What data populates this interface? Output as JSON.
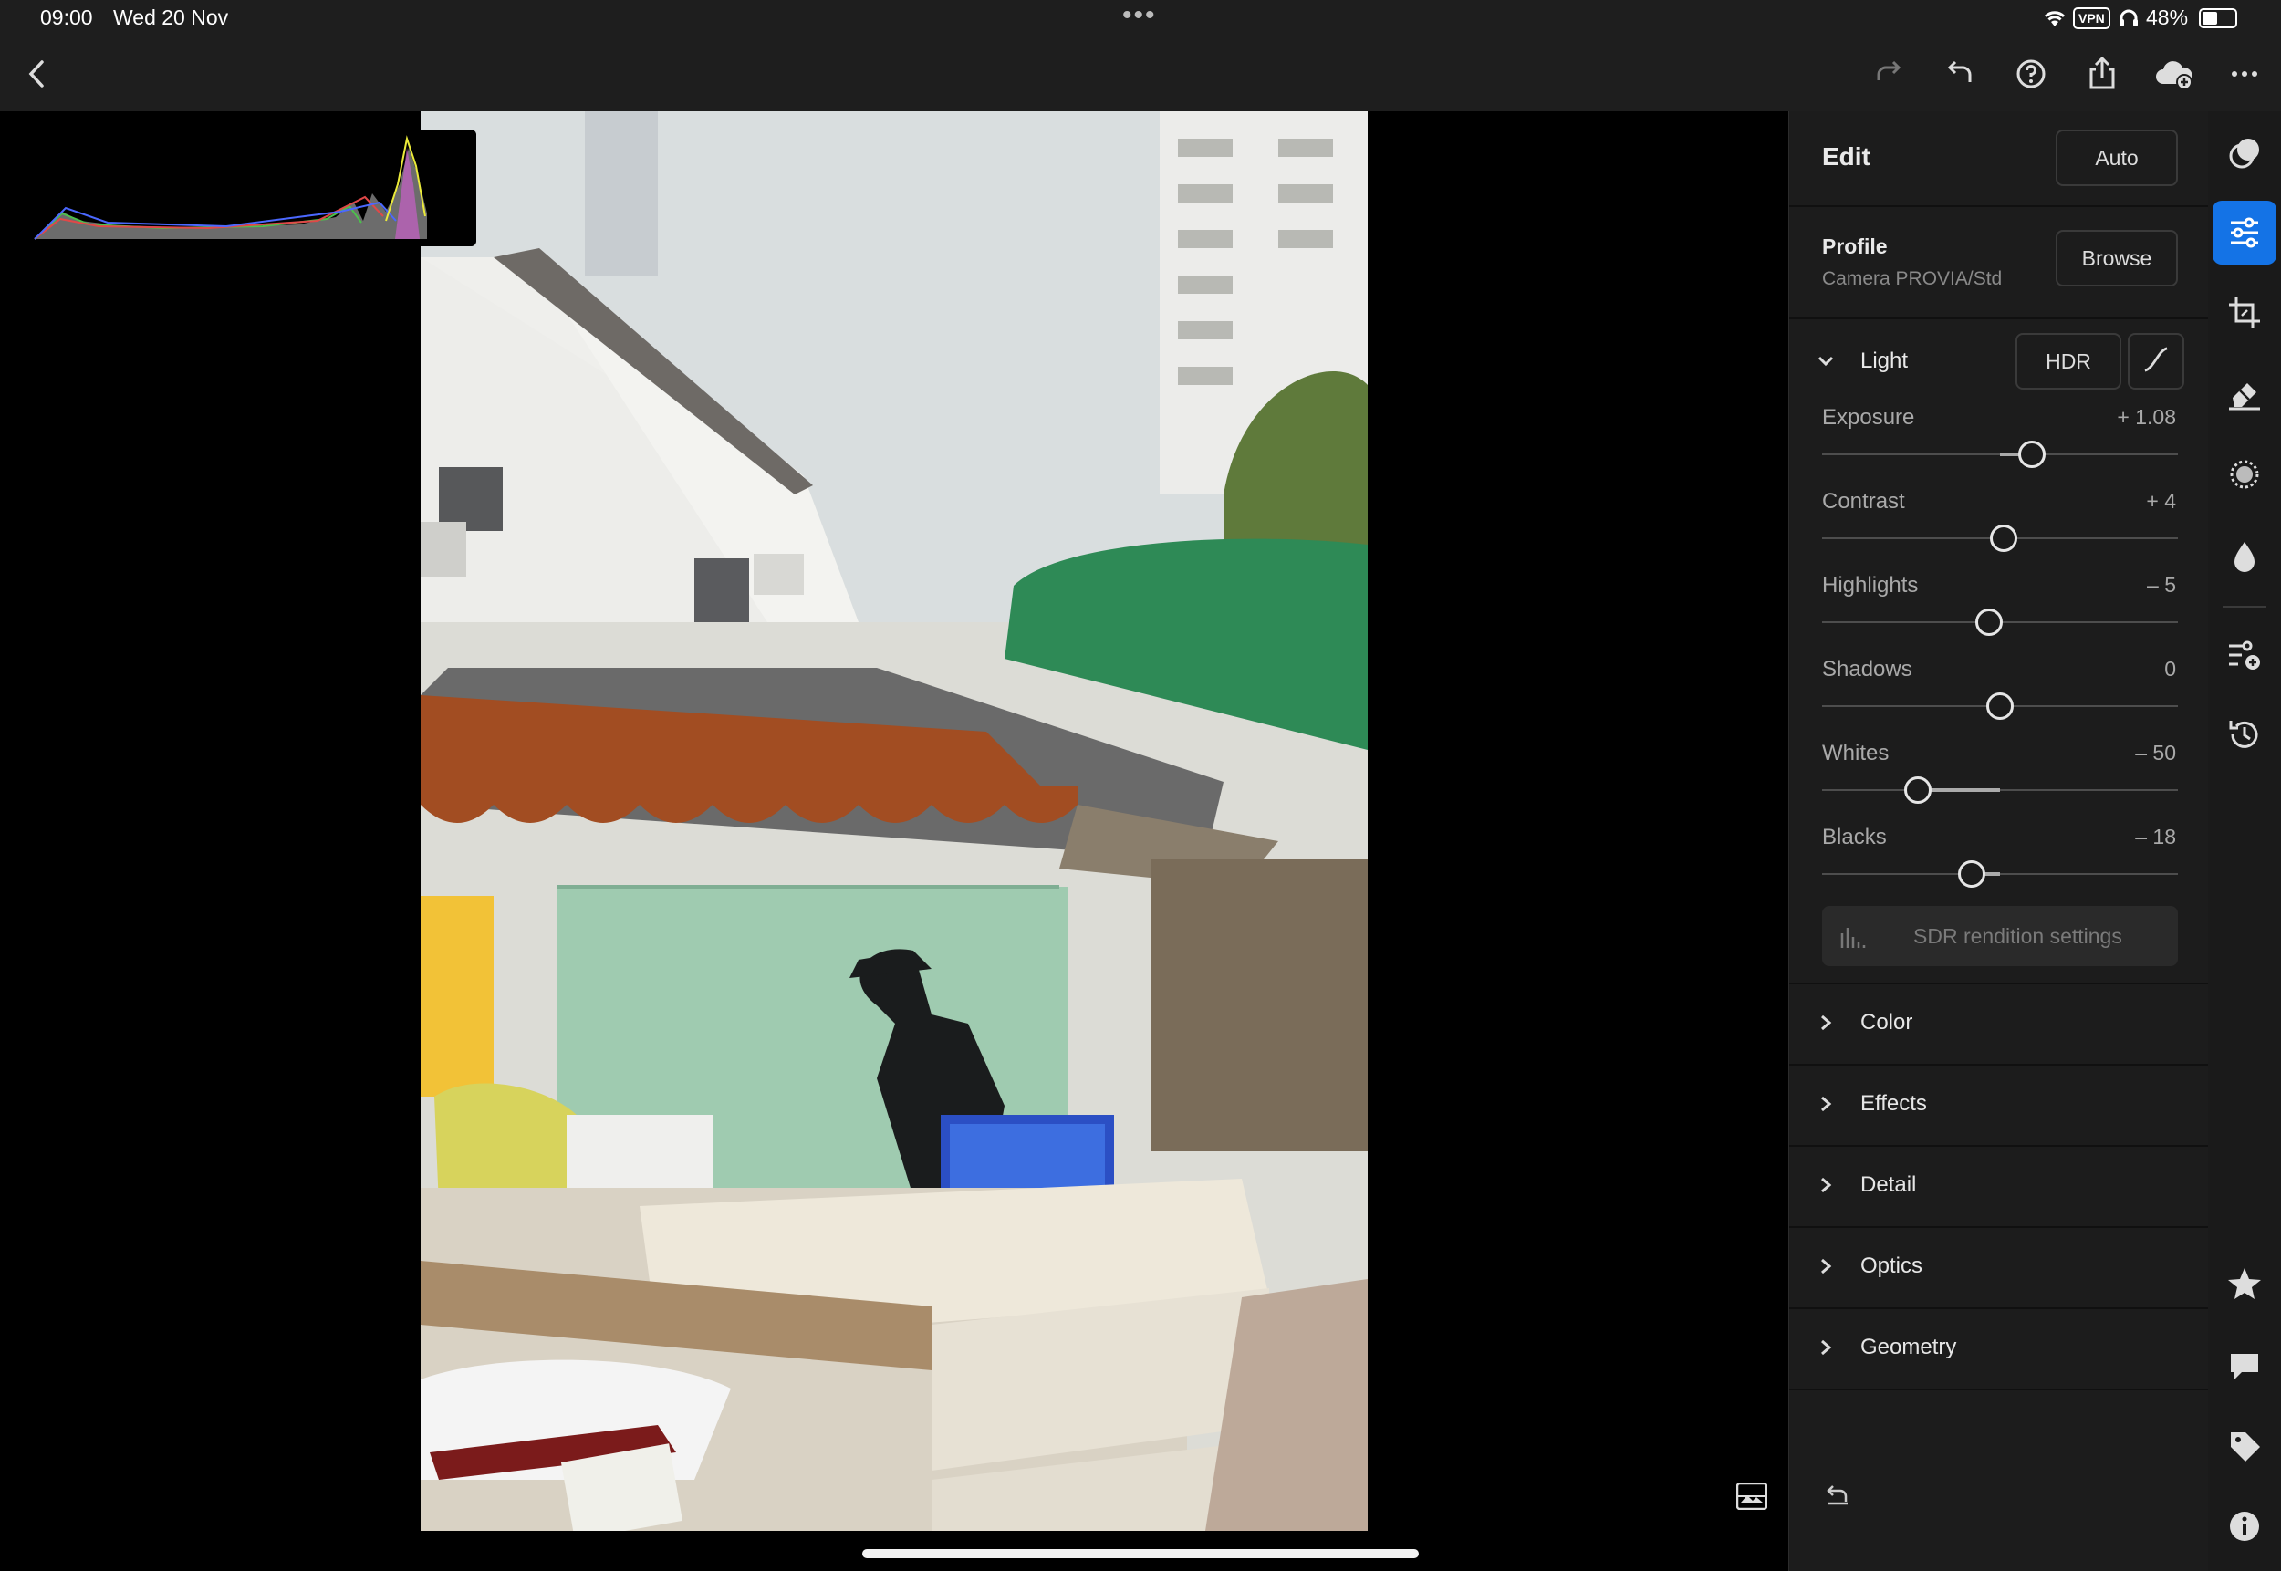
{
  "status": {
    "time": "09:00",
    "date": "Wed 20 Nov",
    "vpn": "VPN",
    "battery": "48%",
    "battery_level": 0.48
  },
  "panel": {
    "title": "Edit",
    "auto_label": "Auto",
    "profile_label": "Profile",
    "profile_value": "Camera PROVIA/Std",
    "browse_label": "Browse",
    "light_label": "Light",
    "hdr_label": "HDR",
    "sdr_label": "SDR rendition settings",
    "sliders": [
      {
        "label": "Exposure",
        "value": "+ 1.08",
        "pos": 0.59
      },
      {
        "label": "Contrast",
        "value": "+ 4",
        "pos": 0.51
      },
      {
        "label": "Highlights",
        "value": "– 5",
        "pos": 0.47
      },
      {
        "label": "Shadows",
        "value": "0",
        "pos": 0.5
      },
      {
        "label": "Whites",
        "value": "– 50",
        "pos": 0.27
      },
      {
        "label": "Blacks",
        "value": "– 18",
        "pos": 0.42
      }
    ],
    "sections": [
      "Color",
      "Effects",
      "Detail",
      "Optics",
      "Geometry"
    ]
  },
  "colors": {
    "accent": "#1473e6",
    "panel_bg": "#1c1c1c",
    "toolbar_bg": "#1e1e1e"
  },
  "icons": {
    "toolbar": [
      "back-icon",
      "redo-icon",
      "undo-icon",
      "help-icon",
      "share-icon",
      "cloud-add-icon",
      "more-icon"
    ],
    "rail": [
      "presets-icon",
      "edit-sliders-icon",
      "crop-icon",
      "healing-icon",
      "masking-icon",
      "blur-icon",
      "versions-icon",
      "history-icon",
      "rating-icon",
      "comments-icon",
      "keywords-icon",
      "info-icon"
    ]
  }
}
